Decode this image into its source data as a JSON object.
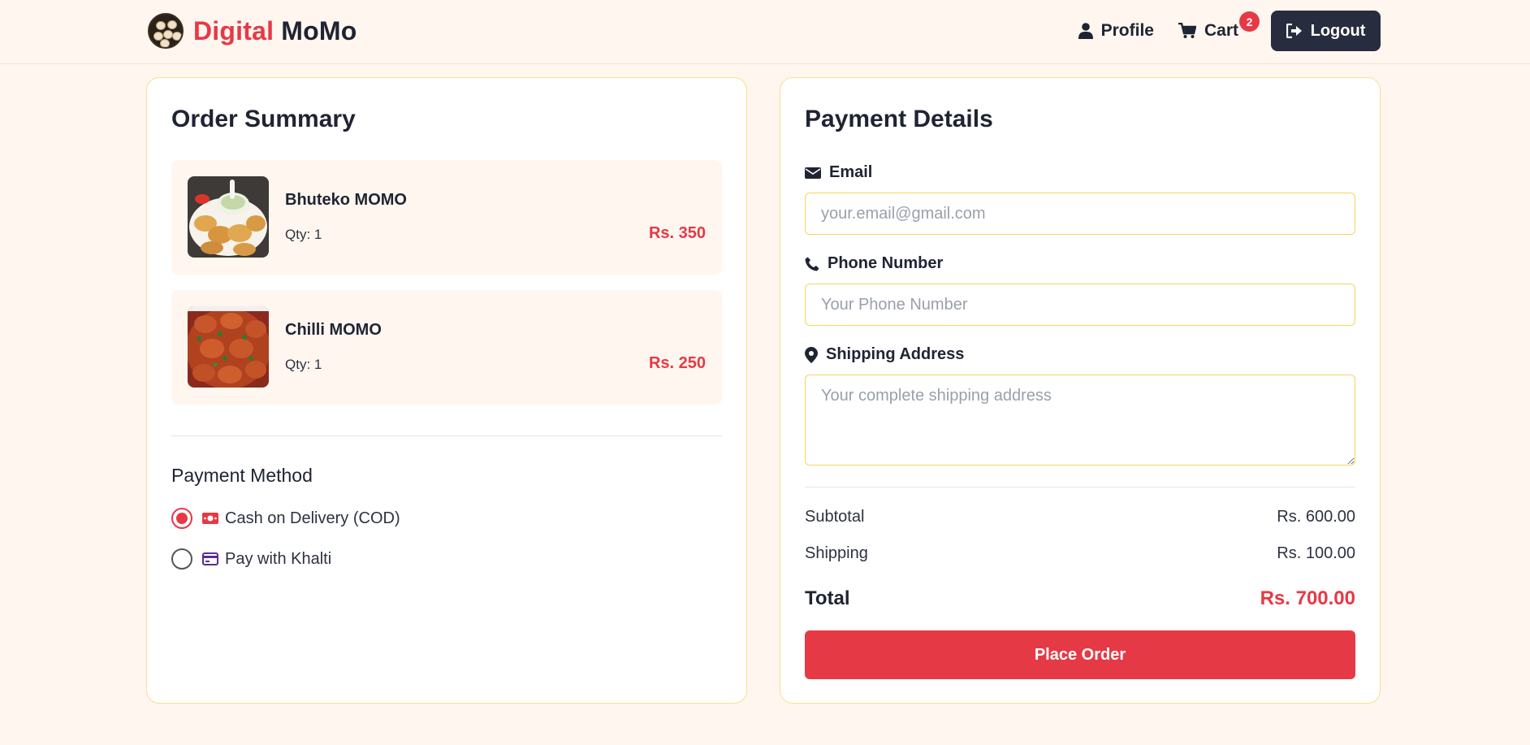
{
  "header": {
    "brand_part1": "Digital",
    "brand_part2": "MoMo",
    "profile_label": "Profile",
    "cart_label": "Cart",
    "cart_count": "2",
    "logout_label": "Logout"
  },
  "order_summary": {
    "title": "Order Summary",
    "items": [
      {
        "name": "Bhuteko MOMO",
        "qty": "Qty: 1",
        "price": "Rs. 350"
      },
      {
        "name": "Chilli MOMO",
        "qty": "Qty: 1",
        "price": "Rs. 250"
      }
    ],
    "payment_method": {
      "title": "Payment Method",
      "options": [
        {
          "label": "Cash on Delivery (COD)",
          "selected": true,
          "icon": "money-icon"
        },
        {
          "label": "Pay with Khalti",
          "selected": false,
          "icon": "credit-card-icon"
        }
      ]
    }
  },
  "payment_details": {
    "title": "Payment Details",
    "email": {
      "label": "Email",
      "placeholder": "your.email@gmail.com",
      "value": ""
    },
    "phone": {
      "label": "Phone Number",
      "placeholder": "Your Phone Number",
      "value": ""
    },
    "address": {
      "label": "Shipping Address",
      "placeholder": "Your complete shipping address",
      "value": ""
    },
    "subtotal_label": "Subtotal",
    "subtotal_value": "Rs. 600.00",
    "shipping_label": "Shipping",
    "shipping_value": "Rs. 100.00",
    "total_label": "Total",
    "total_value": "Rs. 700.00",
    "place_order_label": "Place Order"
  },
  "colors": {
    "accent": "#e63946",
    "dark": "#272d3e",
    "background": "#fff6ef",
    "input_border": "#f3d65c"
  }
}
